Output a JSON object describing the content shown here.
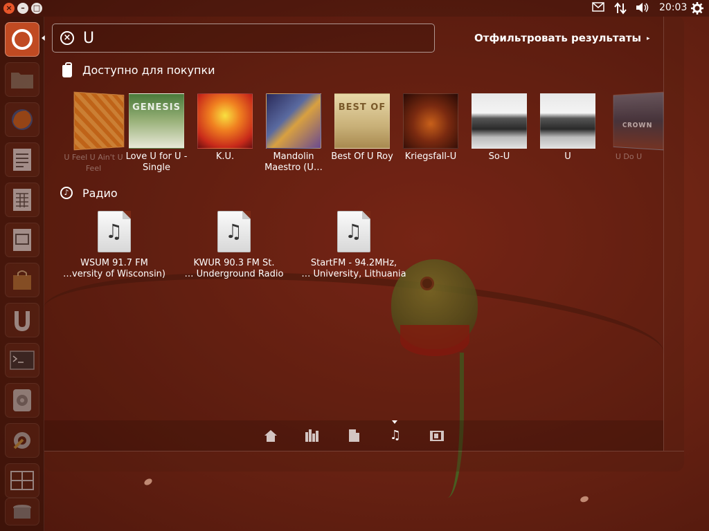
{
  "window_controls": {
    "close": "×",
    "minimize": "–",
    "maximize": "□"
  },
  "tray": {
    "mail_icon": "envelope-icon",
    "network_icon": "network-arrows-icon",
    "volume_icon": "speaker-icon",
    "clock": "20:03",
    "settings_icon": "gear-icon"
  },
  "search": {
    "value": "U",
    "clear_icon": "⊗"
  },
  "filter_button": {
    "label": "Отфильтровать результаты",
    "arrow": "▸"
  },
  "sections": {
    "purchase": {
      "title": "Доступно для покупки"
    },
    "radio": {
      "title": "Радио"
    }
  },
  "albums": [
    {
      "title": "U Feel U Ain't U Feel",
      "faded": true,
      "cover_text": ""
    },
    {
      "title": "Love U for U - Single",
      "faded": false,
      "cover_text": "GENESIS"
    },
    {
      "title": "K.U.",
      "faded": false,
      "cover_text": ""
    },
    {
      "title": "Mandolin Maestro (U…",
      "faded": false,
      "cover_text": ""
    },
    {
      "title": "Best Of U Roy",
      "faded": false,
      "cover_text": "BEST OF"
    },
    {
      "title": "Kriegsfall-U",
      "faded": false,
      "cover_text": ""
    },
    {
      "title": "So-U",
      "faded": false,
      "cover_text": ""
    },
    {
      "title": "U",
      "faded": false,
      "cover_text": ""
    },
    {
      "title": "U Do U",
      "faded": true,
      "cover_text": "CROWN"
    }
  ],
  "radios": [
    {
      "line1": "WSUM 91.7 FM",
      "line2": "…versity of Wisconsin)"
    },
    {
      "line1": "KWUR 90.3 FM St.",
      "line2": "… Underground Radio"
    },
    {
      "line1": "StartFM - 94.2MHz,",
      "line2": "… University, Lithuania"
    }
  ],
  "lenses": [
    {
      "name": "home",
      "icon": "home-icon",
      "active": false
    },
    {
      "name": "applications",
      "icon": "applications-icon",
      "active": false
    },
    {
      "name": "files",
      "icon": "file-icon",
      "active": false
    },
    {
      "name": "music",
      "icon": "music-note-icon",
      "active": true
    },
    {
      "name": "video",
      "icon": "film-icon",
      "active": false
    }
  ],
  "launcher": {
    "items": [
      {
        "name": "dash-home",
        "icon": "ubuntu-logo-icon"
      },
      {
        "name": "home-folder",
        "icon": "folder-icon"
      },
      {
        "name": "firefox",
        "icon": "firefox-icon"
      },
      {
        "name": "libreoffice-writer",
        "icon": "writer-icon"
      },
      {
        "name": "libreoffice-calc",
        "icon": "calc-icon"
      },
      {
        "name": "libreoffice-impress",
        "icon": "impress-icon"
      },
      {
        "name": "software-center",
        "icon": "shopping-bag-icon"
      },
      {
        "name": "ubuntu-one",
        "icon": "ubuntu-one-icon"
      },
      {
        "name": "terminal",
        "icon": "terminal-icon"
      },
      {
        "name": "disk-utility",
        "icon": "disk-icon"
      },
      {
        "name": "system-settings",
        "icon": "settings-gear-icon"
      },
      {
        "name": "workspace-switcher",
        "icon": "workspaces-icon"
      },
      {
        "name": "trash",
        "icon": "trash-icon"
      }
    ]
  },
  "colors": {
    "accent": "#c04a22",
    "background": "#6e2414"
  }
}
